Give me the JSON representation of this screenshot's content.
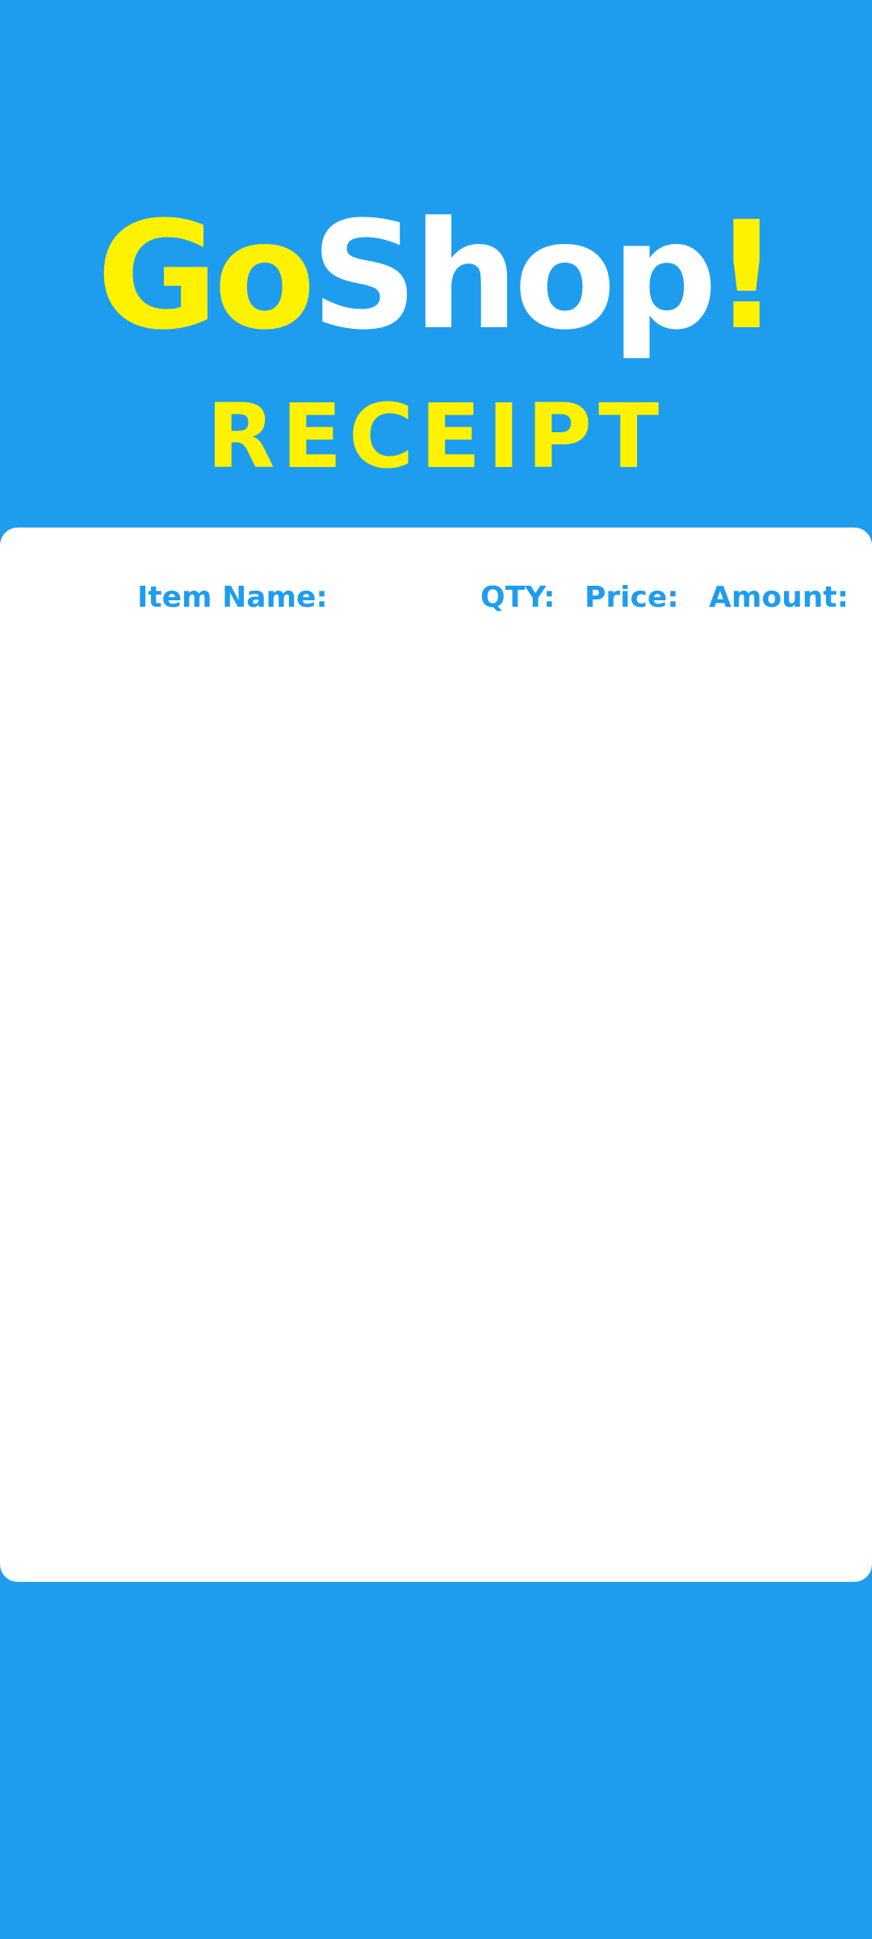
{
  "brand": {
    "part1": "Go",
    "part2": "Shop",
    "part3": "!"
  },
  "title": "RECEIPT",
  "table": {
    "headers": [
      "Item Name:",
      "QTY:",
      "Price:",
      "Amount:"
    ],
    "rows": []
  },
  "colors": {
    "background": "#1e9def",
    "accent": "#fff200",
    "card": "#ffffff"
  }
}
